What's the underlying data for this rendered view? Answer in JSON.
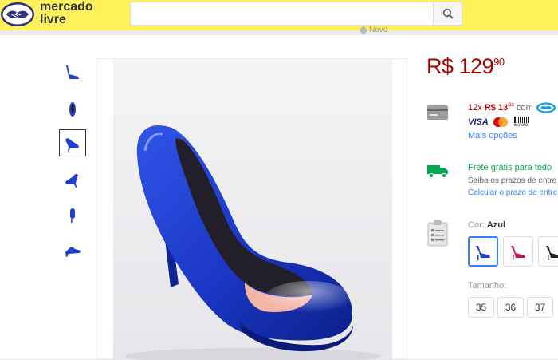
{
  "header": {
    "logo_line1": "mercado",
    "logo_line2": "livre",
    "search_value": "",
    "search_placeholder": ""
  },
  "condition": "Novo",
  "thumbnails": [
    {
      "label": "thumb-1"
    },
    {
      "label": "thumb-2"
    },
    {
      "label": "thumb-3",
      "selected": true
    },
    {
      "label": "thumb-4"
    },
    {
      "label": "thumb-5"
    },
    {
      "label": "thumb-6"
    }
  ],
  "product": {
    "price_currency": "R$",
    "price_int": "129",
    "price_cents": "90",
    "installments_count": "12x",
    "installment_currency": "R$",
    "installment_int": "13",
    "installment_cents": "04",
    "installments_suffix": "com",
    "card_visa": "VISA",
    "card_boleto": "Boleto",
    "more_options": "Mais opções",
    "shipping_title": "Frete grátis para todo",
    "shipping_sub": "Saiba os prazos de entre",
    "shipping_link": "Calcular o prazo de entre",
    "color_label": "Cor:",
    "color_value": "Azul",
    "size_label": "Tamanho:",
    "sizes": [
      "35",
      "36",
      "37"
    ]
  },
  "colors": {
    "brand_yellow": "#fff159",
    "price_red": "#a00000",
    "link_blue": "#3483fa",
    "free_shipping_green": "#00a650",
    "shoe_blue": "#1e3fcf"
  }
}
